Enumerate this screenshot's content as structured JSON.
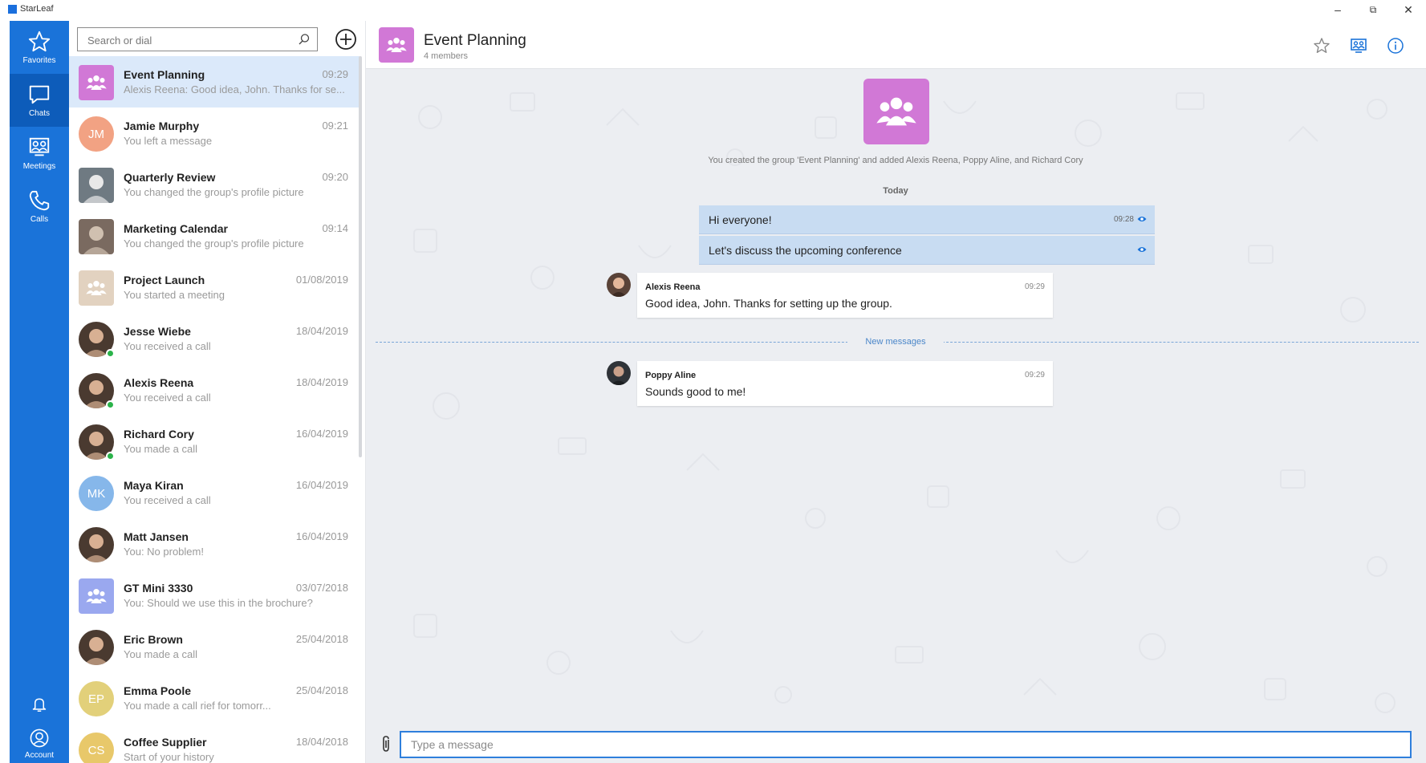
{
  "window": {
    "app_title": "StarLeaf",
    "minimize": "–",
    "restore": "⧉",
    "close": "✕"
  },
  "rail": {
    "favorites": "Favorites",
    "chats": "Chats",
    "meetings": "Meetings",
    "calls": "Calls",
    "account": "Account",
    "accent": "#1a73d9"
  },
  "search": {
    "placeholder": "Search or dial"
  },
  "conversations": [
    {
      "name": "Event Planning",
      "time": "09:29",
      "preview": "Alexis Reena: Good idea, John. Thanks for se...",
      "avatar": "group",
      "avatar_color": "#d178d6",
      "active": true
    },
    {
      "name": "Jamie Murphy",
      "time": "09:21",
      "preview": "You left a message",
      "initials": "JM",
      "avatar_color": "#f2a283"
    },
    {
      "name": "Quarterly Review",
      "time": "09:20",
      "preview": "You changed the group's profile picture",
      "avatar": "photo-doc"
    },
    {
      "name": "Marketing Calendar",
      "time": "09:14",
      "preview": "You changed the group's profile picture",
      "avatar": "photo-pen"
    },
    {
      "name": "Project Launch",
      "time": "01/08/2019",
      "preview": "You started a meeting",
      "avatar": "group",
      "avatar_color": "#e2d2c0"
    },
    {
      "name": "Jesse Wiebe",
      "time": "18/04/2019",
      "preview": "You received a call",
      "avatar": "photo-person",
      "presence": true
    },
    {
      "name": "Alexis Reena",
      "time": "18/04/2019",
      "preview": "You received a call",
      "avatar": "photo-person",
      "presence": true
    },
    {
      "name": "Richard Cory",
      "time": "16/04/2019",
      "preview": "You made a call",
      "avatar": "photo-person",
      "presence": true
    },
    {
      "name": "Maya Kiran",
      "time": "16/04/2019",
      "preview": "You received a call",
      "initials": "MK",
      "avatar_color": "#86b7ea"
    },
    {
      "name": "Matt Jansen",
      "time": "16/04/2019",
      "preview": "You: No problem!",
      "avatar": "photo-person"
    },
    {
      "name": "GT Mini 3330",
      "time": "03/07/2018",
      "preview": "You: Should we use this in the brochure?",
      "avatar": "group",
      "avatar_color": "#9aa8ef"
    },
    {
      "name": "Eric Brown",
      "time": "25/04/2018",
      "preview": "You made a call",
      "avatar": "photo-person"
    },
    {
      "name": "Emma Poole",
      "time": "25/04/2018",
      "preview": "You made a call                          rief for tomorr...",
      "initials": "EP",
      "avatar_color": "#e2d07a"
    },
    {
      "name": "Coffee Supplier",
      "time": "18/04/2018",
      "preview": "Start of your history",
      "initials": "CS",
      "avatar_color": "#e8c86a"
    }
  ],
  "chat": {
    "title": "Event Planning",
    "members": "4 members",
    "created_notice": "You created the group 'Event Planning' and added Alexis Reena, Poppy Aline, and Richard Cory",
    "day_label": "Today",
    "outgoing": [
      {
        "text": "Hi everyone!",
        "time": "09:28"
      },
      {
        "text": "Let's discuss the upcoming conference",
        "time": ""
      }
    ],
    "incoming": [
      {
        "sender": "Alexis Reena",
        "time": "09:29",
        "text": "Good idea, John. Thanks for setting up the group."
      },
      {
        "sender": "Poppy Aline",
        "time": "09:29",
        "text": "Sounds good to me!"
      }
    ],
    "new_messages_label": "New messages",
    "composer_placeholder": "Type a message",
    "group_color": "#d178d6",
    "outgoing_bubble_color": "#c8dcf2"
  }
}
